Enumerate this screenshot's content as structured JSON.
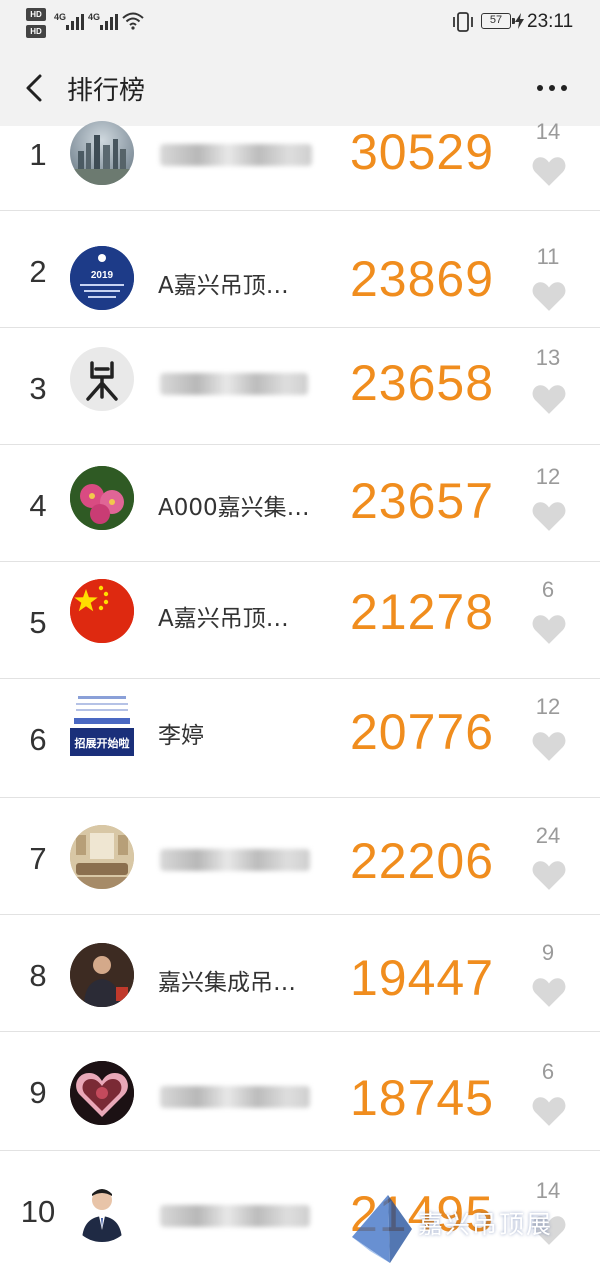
{
  "status_bar": {
    "sim1": "HD",
    "sim1_sub": "1",
    "sim2": "HD",
    "sim2_sub": "2",
    "network1": "4G",
    "network2": "4G",
    "battery": "57",
    "time": "23:11"
  },
  "header": {
    "title": "排行榜"
  },
  "rows": [
    {
      "rank": "1",
      "name": "",
      "steps": "30529",
      "likes": "14"
    },
    {
      "rank": "2",
      "name": "A嘉兴吊顶…",
      "steps": "23869",
      "likes": "11"
    },
    {
      "rank": "3",
      "name": "",
      "steps": "23658",
      "likes": "13"
    },
    {
      "rank": "4",
      "name": "A000嘉兴集…",
      "steps": "23657",
      "likes": "12"
    },
    {
      "rank": "5",
      "name": "A嘉兴吊顶…",
      "steps": "21278",
      "likes": "6"
    },
    {
      "rank": "6",
      "name": "李婷",
      "steps": "20776",
      "likes": "12"
    },
    {
      "rank": "7",
      "name": "",
      "steps": "22206",
      "likes": "24"
    },
    {
      "rank": "8",
      "name": "嘉兴集成吊…",
      "steps": "19447",
      "likes": "9"
    },
    {
      "rank": "9",
      "name": "",
      "steps": "18745",
      "likes": "6"
    },
    {
      "rank": "10",
      "name": "",
      "steps": "21495",
      "likes": "14"
    }
  ],
  "avatars": {
    "row2_year": "2019",
    "row6_banner": "招展开始啦"
  },
  "watermark": "嘉兴吊顶展",
  "colors": {
    "steps": "#f08d1e",
    "background": "#ffffff",
    "header": "#f2f2f2",
    "heart": "#d8d8d8"
  },
  "icons": {
    "back": "back-arrow-icon",
    "more": "more-dots-icon",
    "like": "heart-icon",
    "wifi": "wifi-icon",
    "signal": "signal-icon",
    "vibrate": "vibrate-icon",
    "battery": "battery-icon"
  }
}
